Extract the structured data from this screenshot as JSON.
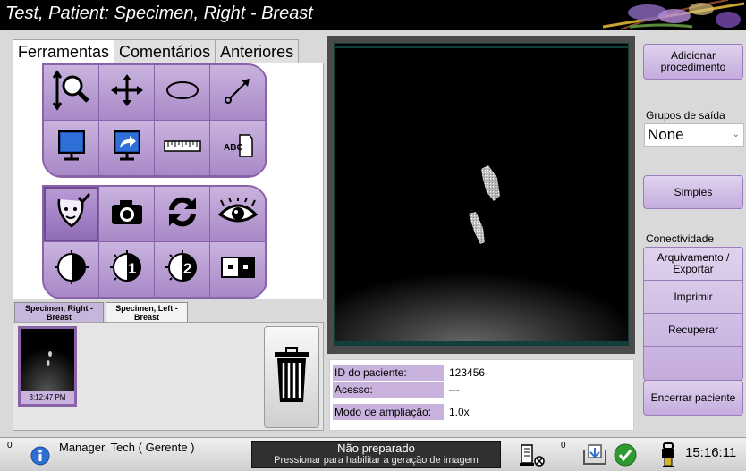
{
  "title": "Test, Patient:  Specimen, Right - Breast",
  "tabs": [
    {
      "label": "Ferramentas",
      "active": true
    },
    {
      "label": "Comentários",
      "active": false
    },
    {
      "label": "Anteriores",
      "active": false
    }
  ],
  "tool_groups": {
    "group1": [
      "zoom-magnify-icon",
      "pan-icon",
      "ellipse-icon",
      "arrow-icon",
      "monitor-icon",
      "send-image-icon",
      "ruler-icon",
      "text-annotation-icon"
    ],
    "group2": [
      "face-check-icon",
      "camera-icon",
      "refresh-icon",
      "eye-icon",
      "contrast-icon",
      "contrast-1-icon",
      "contrast-2-icon",
      "invert-icon"
    ]
  },
  "series_tabs": [
    {
      "label": "Specimen, Right - Breast",
      "active": true
    },
    {
      "label": "Specimen, Left - Breast",
      "active": false
    }
  ],
  "thumbnail": {
    "time": "3:12:47 PM"
  },
  "patient_info": {
    "id_label": "ID do paciente:",
    "id_value": "123456",
    "access_label": "Acesso:",
    "access_value": "---",
    "mag_label": "Modo de ampliação:",
    "mag_value": "1.0x"
  },
  "right_panel": {
    "add_procedure": "Adicionar procedimento",
    "output_groups_label": "Grupos de saída",
    "output_group_selected": "None",
    "simple_button": "Simples",
    "connectivity_label": "Conectividade",
    "archive_export": "Arquivamento / Exportar",
    "print": "Imprimir",
    "retrieve": "Recuperar",
    "close_patient": "Encerrar paciente"
  },
  "status_bar": {
    "left_count": "0",
    "user": "Manager, Tech ( Gerente )",
    "not_ready_title": "Não preparado",
    "not_ready_sub": "Pressionar para habilitar a geração de imagem",
    "queue_count": "0",
    "clock": "15:16:11"
  },
  "colors": {
    "accent": "#a889c7",
    "accent_dark": "#8a62aa",
    "background": "#d9d9d9",
    "title_bar": "#000000"
  }
}
